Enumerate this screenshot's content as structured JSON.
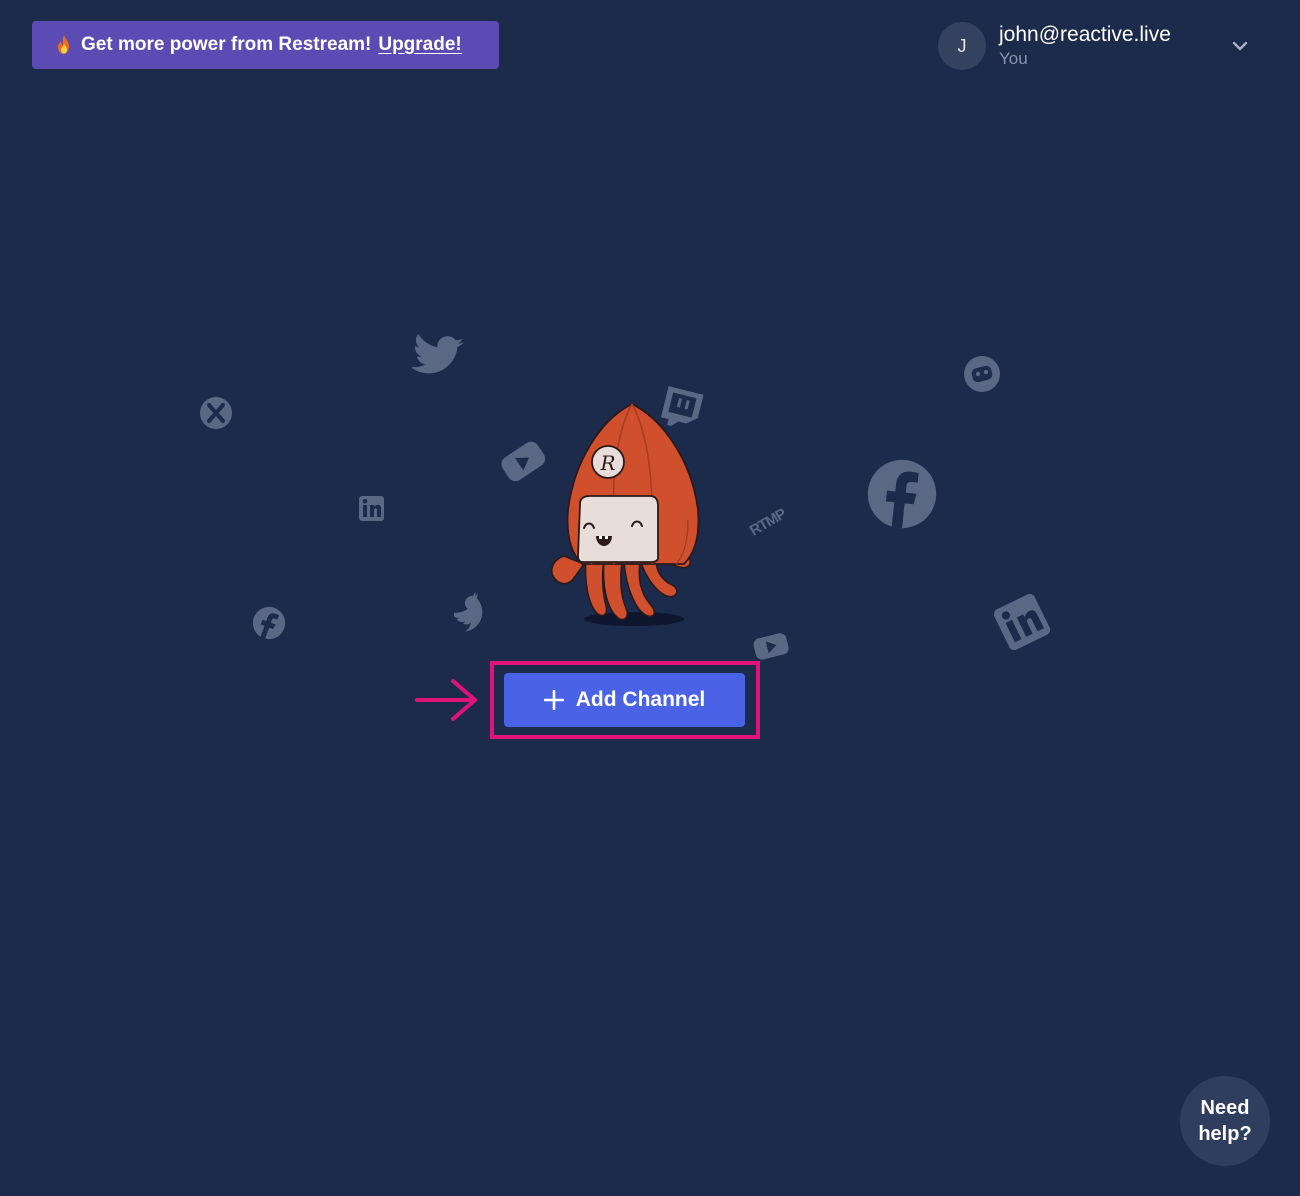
{
  "banner": {
    "text": "Get more power from Restream!",
    "link": "Upgrade!",
    "icon": "fire-icon"
  },
  "user": {
    "initial": "J",
    "email": "john@reactive.live",
    "role": "You"
  },
  "illustration": {
    "mascot_badge": "R",
    "rtmp_label": "RTMP",
    "icons": [
      "twitter-icon",
      "twitch-icon",
      "youtube-icon",
      "facebook-icon",
      "linkedin-icon",
      "mixer-icon",
      "discord-icon"
    ]
  },
  "add_channel": {
    "label": "Add Channel"
  },
  "help": {
    "label_line1": "Need",
    "label_line2": "help?"
  },
  "colors": {
    "background": "#1c2a4b",
    "banner": "#5b4bb3",
    "button": "#4a63e6",
    "highlight": "#e0137a",
    "icon_muted": "#5a6884",
    "mascot": "#d0502e"
  }
}
